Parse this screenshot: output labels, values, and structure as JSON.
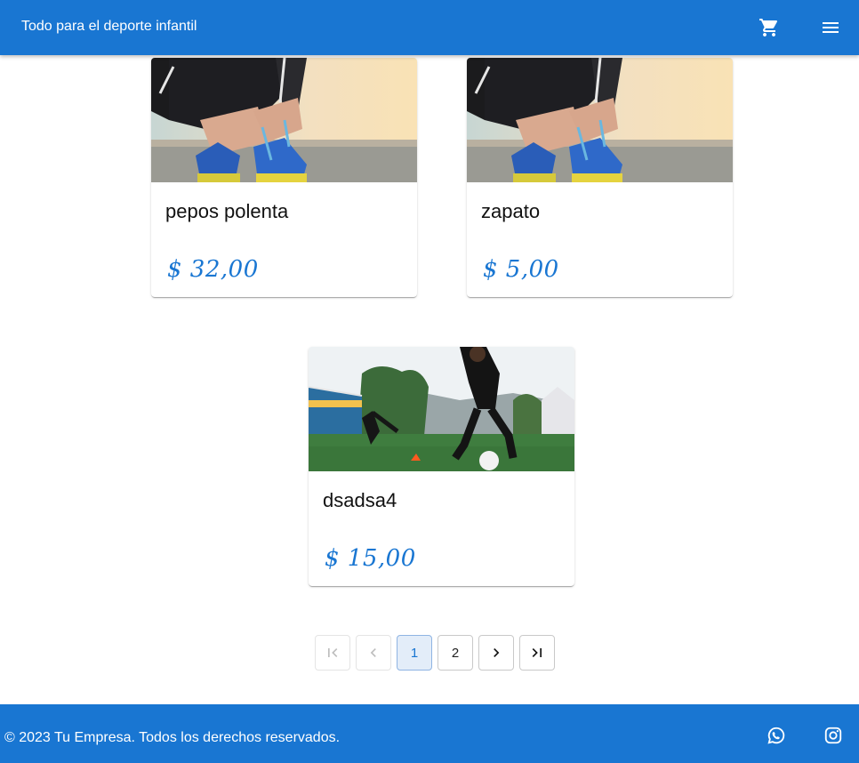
{
  "header": {
    "title": "Todo para el deporte infantil",
    "icons": {
      "cart": "shopping-cart-icon",
      "menu": "hamburger-menu-icon"
    },
    "background_color": "#1976d2"
  },
  "products": [
    {
      "name": "pepos polenta",
      "price": "$ 32,00",
      "image": "running-shoes-lacing-photo"
    },
    {
      "name": "zapato",
      "price": "$ 5,00",
      "image": "running-shoes-lacing-photo"
    },
    {
      "name": "dsadsa4",
      "price": "$ 15,00",
      "image": "soccer-player-field-photo"
    }
  ],
  "pagination": {
    "current_page": 1,
    "pages": [
      "1",
      "2"
    ],
    "icons": {
      "first": "first-page-icon",
      "prev": "chevron-left-icon",
      "next": "chevron-right-icon",
      "last": "last-page-icon"
    }
  },
  "footer": {
    "copyright": "© 2023 Tu Empresa. Todos los derechos reservados.",
    "icons": {
      "whatsapp": "whatsapp-icon",
      "instagram": "instagram-icon"
    }
  },
  "colors": {
    "primary": "#1976d2",
    "price": "#1976d2",
    "active_page_bg": "#e3edf9"
  }
}
